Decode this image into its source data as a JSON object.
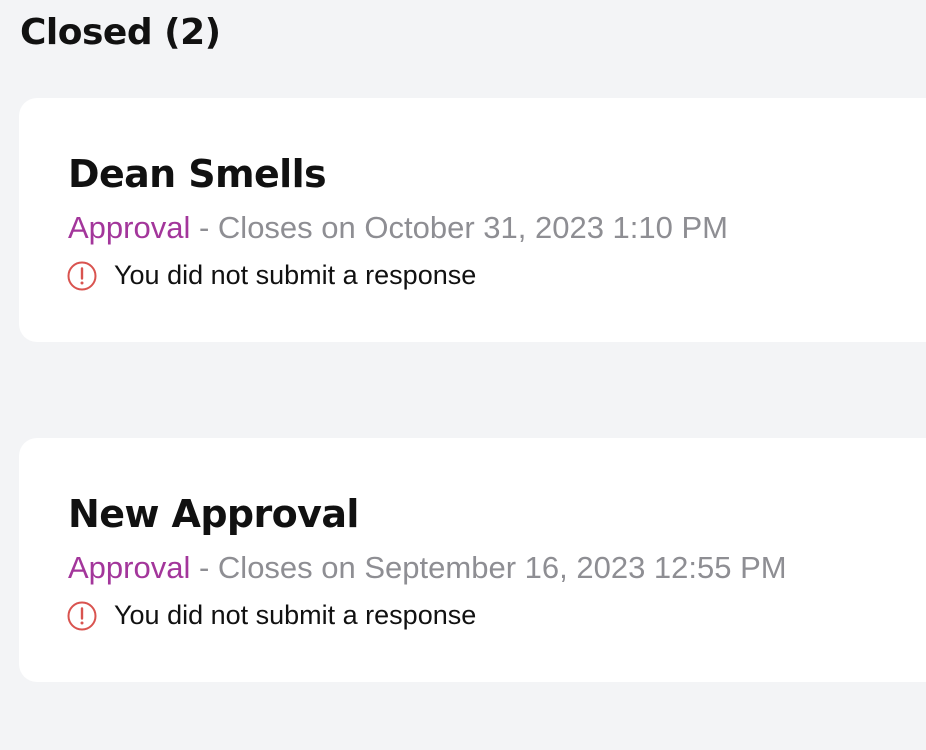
{
  "section": {
    "title": "Closed (2)"
  },
  "cards": [
    {
      "title": "Dean Smells",
      "type": "Approval",
      "separator": " - ",
      "closes_text": "Closes on October 31, 2023 1:10 PM",
      "status_icon": "alert-circle-icon",
      "status_text": "You did not submit a response"
    },
    {
      "title": "New Approval",
      "type": "Approval",
      "separator": " - ",
      "closes_text": "Closes on September 16, 2023 12:55 PM",
      "status_icon": "alert-circle-icon",
      "status_text": "You did not submit a response"
    }
  ],
  "colors": {
    "background": "#f3f4f6",
    "card": "#ffffff",
    "type_accent": "#a3369b",
    "meta_gray": "#8e8e93",
    "alert_red": "#d9534f"
  }
}
